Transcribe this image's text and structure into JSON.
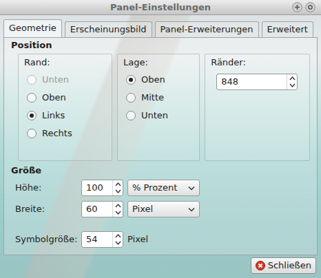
{
  "window": {
    "title": "Panel-Einstellungen"
  },
  "tabs": [
    {
      "label": "Geometrie",
      "selected": true
    },
    {
      "label": "Erscheinungsbild",
      "selected": false
    },
    {
      "label": "Panel-Erweiterungen",
      "selected": false
    },
    {
      "label": "Erweitert",
      "selected": false
    }
  ],
  "sections": {
    "position": {
      "title": "Position",
      "edge": {
        "label": "Rand:",
        "options": [
          {
            "label": "Unten",
            "selected": false,
            "disabled": true
          },
          {
            "label": "Oben",
            "selected": false,
            "disabled": false
          },
          {
            "label": "Links",
            "selected": true,
            "disabled": false
          },
          {
            "label": "Rechts",
            "selected": false,
            "disabled": false
          }
        ]
      },
      "alignment": {
        "label": "Lage:",
        "options": [
          {
            "label": "Oben",
            "selected": true,
            "disabled": false
          },
          {
            "label": "Mitte",
            "selected": false,
            "disabled": false
          },
          {
            "label": "Unten",
            "selected": false,
            "disabled": false
          }
        ]
      },
      "margin": {
        "label": "Ränder:",
        "value": "848"
      }
    },
    "size": {
      "title": "Größe",
      "rows": [
        {
          "label": "Höhe:",
          "value": "100",
          "unit": "% Prozent",
          "kind": "dropdown"
        },
        {
          "label": "Breite:",
          "value": "60",
          "unit": "Pixel",
          "kind": "dropdown"
        },
        {
          "label": "Symbolgröße:",
          "value": "54",
          "unit": "Pixel",
          "kind": "plain"
        }
      ]
    }
  },
  "buttons": [
    {
      "label": "Schließen"
    }
  ]
}
